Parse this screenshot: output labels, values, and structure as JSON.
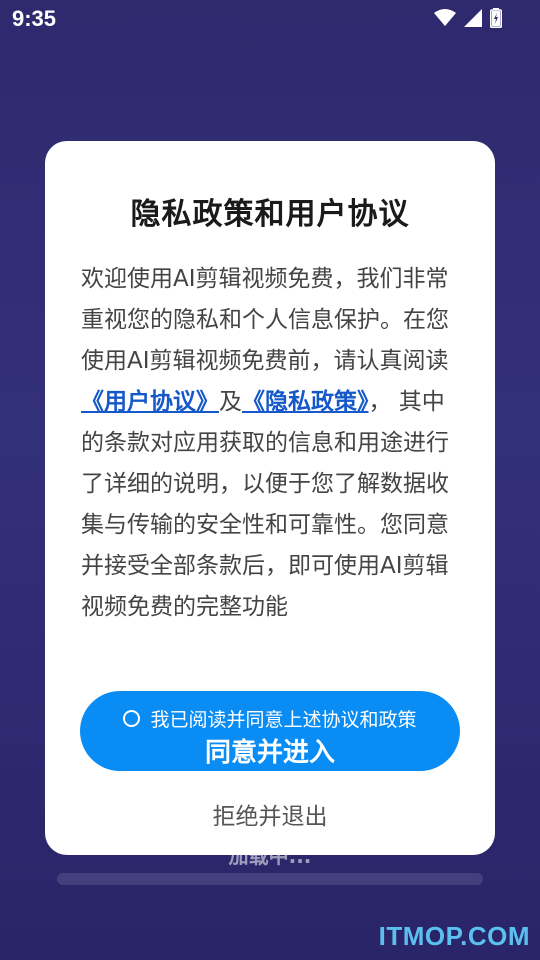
{
  "status_bar": {
    "time": "9:35",
    "icons": [
      "wifi-icon",
      "signal-icon",
      "battery-charging-icon"
    ]
  },
  "background": {
    "loading_text": "加载中..."
  },
  "dialog": {
    "title": "隐私政策和用户协议",
    "body_intro": "欢迎使用AI剪辑视频免费，我们非常重视您的隐私和个人信息保护。在您使用AI剪辑视频免费前，请认真阅读",
    "user_agreement_link": "《用户协议》",
    "conjunction": "及",
    "privacy_policy_link": "《隐私政策》",
    "body_rest": "， 其中的条款对应用获取的信息和用途进行了详细的说明，以便于您了解数据收集与传输的安全性和可靠性。您同意并接受全部条款后，即可使用AI剪辑视频免费的完整功能",
    "consent_label": "我已阅读并同意上述协议和政策",
    "agree_button_label": "同意并进入",
    "reject_button_label": "拒绝并退出"
  },
  "watermark": "ITMOP.COM",
  "colors": {
    "background": "#2f2a6e",
    "accent_button": "#0a8cf5",
    "link": "#1558c9"
  }
}
